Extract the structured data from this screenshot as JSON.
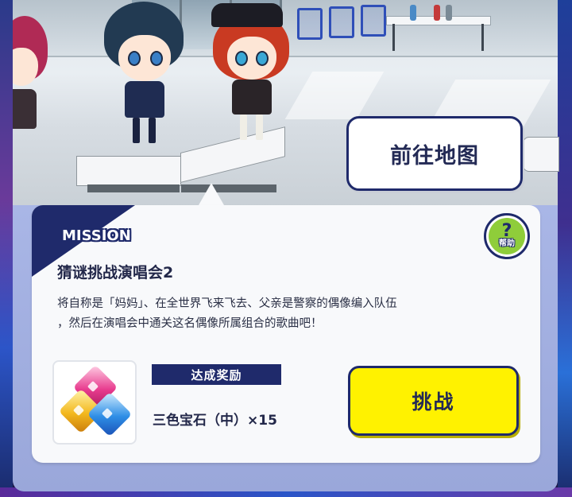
{
  "scene": {
    "map_button_label": "前往地图"
  },
  "mission": {
    "tag": "MISSION",
    "title": "猜谜挑战演唱会2",
    "description_line1": "将自称是「妈妈」、在全世界飞来飞去、父亲是警察的偶像编入队伍",
    "description_line2": "，然后在演唱会中通关这名偶像所属组合的歌曲吧！",
    "help_icon": "?",
    "help_label": "帮助"
  },
  "reward": {
    "header": "达成奖励",
    "item_text": "三色宝石（中）×15",
    "item_icon": "tri-color-gem-icon"
  },
  "actions": {
    "challenge_label": "挑战"
  },
  "colors": {
    "navy": "#1f2a6b",
    "challenge_yellow": "#fff200",
    "help_green": "#8fcd3a"
  }
}
